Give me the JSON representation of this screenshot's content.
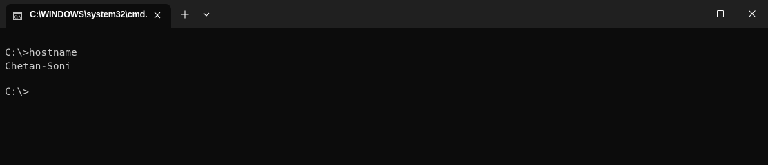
{
  "tab": {
    "icon": "cmd-icon",
    "title": "C:\\WINDOWS\\system32\\cmd."
  },
  "titlebar": {
    "new_tab_icon": "plus-icon",
    "dropdown_icon": "chevron-down-icon",
    "minimize_icon": "minimize-icon",
    "maximize_icon": "maximize-icon",
    "close_icon": "close-icon"
  },
  "console": {
    "lines": [
      "C:\\>hostname",
      "Chetan-Soni",
      "C:\\>"
    ],
    "text_color": "#cccccc",
    "background": "#0c0c0c"
  }
}
